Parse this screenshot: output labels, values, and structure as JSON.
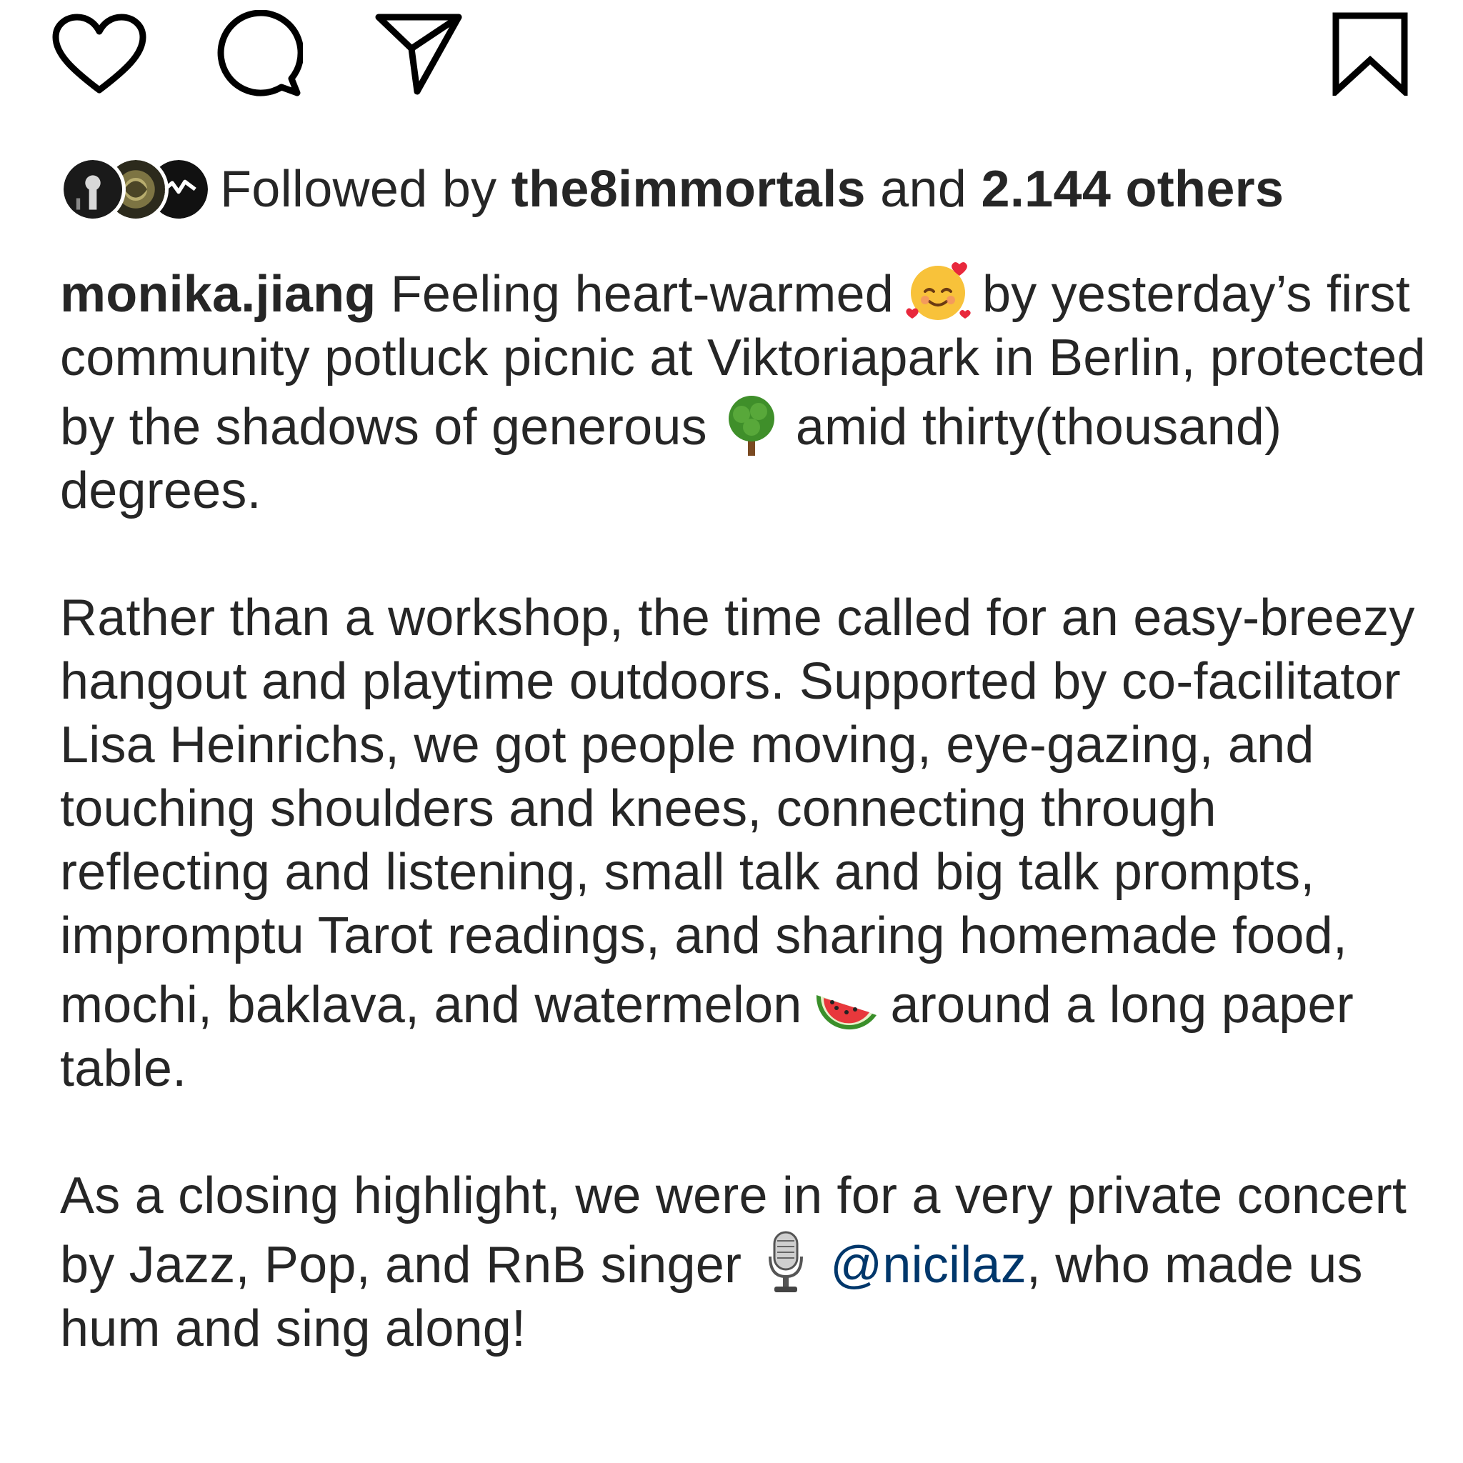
{
  "actions": {
    "like_icon": "heart-outline",
    "comment_icon": "speech-bubble-outline",
    "share_icon": "paper-plane-outline",
    "save_icon": "bookmark-outline"
  },
  "followed_by": {
    "prefix": "Followed by ",
    "account": "the8immortals",
    "middle": " and ",
    "others": "2.144 others"
  },
  "caption": {
    "username": "monika.jiang",
    "p1_a": " Feeling heart-warmed",
    "p1_emoji": "smiling-face-with-hearts",
    "p1_b": "by yesterday’s first community potluck picnic at Viktoriapark in Berlin, protected by the shadows of generous",
    "p1_emoji2": "deciduous-tree",
    "p1_c": "amid thirty(thousand) degrees.",
    "p2_a": "Rather than a workshop, the time called for an easy-breezy hangout and playtime outdoors. Supported by co-facilitator Lisa Heinrichs, we got people moving, eye-gazing, and touching shoulders and knees, connecting through reflecting and listening, small talk and big talk prompts, impromptu Tarot readings, and sharing homemade food, mochi, baklava, and watermelon",
    "p2_emoji": "watermelon",
    "p2_b": "around a long paper table.",
    "p3_a": "As a closing highlight, we were in for a very private concert by Jazz, Pop, and RnB singer",
    "p3_emoji": "studio-microphone",
    "p3_mention": "@nicilaz",
    "p3_b": ", who made us hum and sing along!"
  },
  "colors": {
    "text": "#262626",
    "mention": "#00376b",
    "background": "#ffffff"
  }
}
